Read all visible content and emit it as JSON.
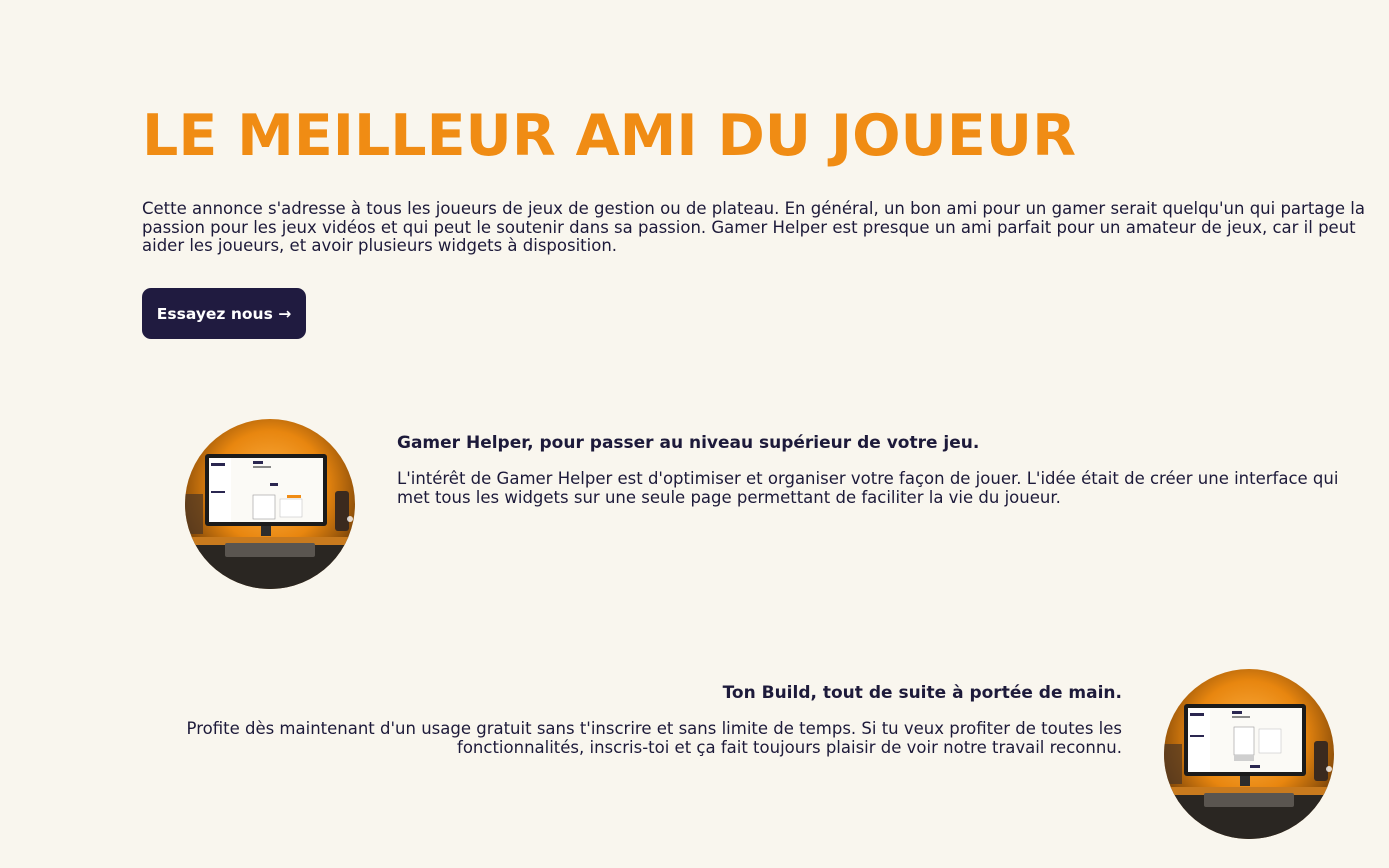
{
  "hero": {
    "title": "LE MEILLEUR AMI DU JOUEUR",
    "description": "Cette annonce s'adresse à tous les joueurs de jeux de gestion ou de plateau. En général, un bon ami pour un gamer serait quelqu'un qui partage la passion pour les jeux vidéos et qui peut le soutenir dans sa passion. Gamer Helper est presque un ami parfait pour un amateur de jeux, car il peut aider les joueurs, et avoir plusieurs widgets à disposition.",
    "cta_label": "Essayez nous →"
  },
  "features": [
    {
      "title": "Gamer Helper, pour passer au niveau supérieur de votre jeu.",
      "text": "L'intérêt de Gamer Helper est d'optimiser et organiser votre façon de jouer. L'idée était de créer une interface qui met tous les widgets sur une seule page permettant de faciliter la vie du joueur.",
      "image": "desk-computer-photo"
    },
    {
      "title": "Ton Build, tout de suite à portée de main.",
      "text": "Profite dès maintenant d'un usage gratuit sans t'inscrire et sans limite de temps. Si tu veux profiter de toutes les fonctionnalités, inscris-toi et ça fait toujours plaisir de voir notre travail reconnu.",
      "image": "desk-computer-photo"
    }
  ],
  "colors": {
    "background": "#f9f6ee",
    "accent": "#f08c14",
    "button": "#201b40",
    "text": "#1d1a3a"
  }
}
